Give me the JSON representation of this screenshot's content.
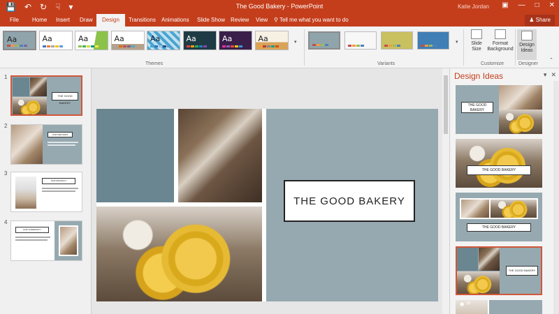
{
  "app": {
    "doc_title": "The Good Bakery - PowerPoint",
    "user": "Katie Jordan",
    "share_label": "Share"
  },
  "qat": {
    "save_icon": "save-icon",
    "undo_icon": "undo-icon",
    "redo_icon": "redo-icon",
    "touch_icon": "touch-mode-icon",
    "more_icon": "customize-qat-icon"
  },
  "tabs": [
    {
      "label": "File",
      "active": false
    },
    {
      "label": "Home",
      "active": false
    },
    {
      "label": "Insert",
      "active": false
    },
    {
      "label": "Draw",
      "active": false
    },
    {
      "label": "Design",
      "active": true
    },
    {
      "label": "Transitions",
      "active": false
    },
    {
      "label": "Animations",
      "active": false
    },
    {
      "label": "Slide Show",
      "active": false
    },
    {
      "label": "Review",
      "active": false
    },
    {
      "label": "View",
      "active": false
    }
  ],
  "tell_me": "Tell me what you want to do",
  "ribbon": {
    "themes_label": "Themes",
    "variants_label": "Variants",
    "customize_label": "Customize",
    "designer_label": "Designer",
    "theme_aa": "Aa",
    "slide_size_label": "Slide Size",
    "format_background_label": "Format Background",
    "design_ideas_label": "Design Ideas",
    "theme_colors": [
      [
        "#c0504d",
        "#f79646",
        "#9bbb59",
        "#4f81bd",
        "#8064a2"
      ],
      [
        "#4472c4",
        "#ed7d31",
        "#a5a5a5",
        "#ffc000",
        "#5b9bd5"
      ],
      [
        "#8bc34a",
        "#4caf50",
        "#cddc39",
        "#009688",
        "#ffeb3b"
      ],
      [
        "#a5a5a5",
        "#e46c0a",
        "#c0504d",
        "#7f6084",
        "#4bacc6"
      ],
      [
        "#3fa9d6",
        "#2e75b6",
        "#9dc3e6",
        "#1f4e79",
        "#5b9bd5"
      ],
      [
        "#e83e3e",
        "#f39c12",
        "#27ae60",
        "#2980b9",
        "#8e44ad"
      ],
      [
        "#e6339a",
        "#9b59b6",
        "#e74c3c",
        "#f1c40f",
        "#3498db"
      ],
      [
        "#e8a33b",
        "#c0392b",
        "#7f8c8d",
        "#16a085",
        "#d35400"
      ]
    ],
    "variant_colors": [
      {
        "bg": "#8fa4ab",
        "bars": [
          "#c0504d",
          "#f79646",
          "#9bbb59",
          "#4f81bd"
        ]
      },
      {
        "bg": "#f7f7f7",
        "bars": [
          "#c0504d",
          "#f79646",
          "#9bbb59",
          "#4f81bd"
        ]
      },
      {
        "bg": "#c9c060",
        "bars": [
          "#c0504d",
          "#f79646",
          "#9bbb59",
          "#4f81bd"
        ]
      },
      {
        "bg": "#3f7fb5",
        "bars": [
          "#c0504d",
          "#f79646",
          "#9bbb59",
          "#4f81bd"
        ]
      }
    ]
  },
  "slides": [
    {
      "num": "1",
      "title": "THE GOOD BAKERY"
    },
    {
      "num": "2",
      "title": "OUR METHODS"
    },
    {
      "num": "3",
      "title": "OUR PRODUCT"
    },
    {
      "num": "4",
      "title": "OUR COMMUNITY"
    }
  ],
  "main_slide": {
    "title": "THE GOOD BAKERY",
    "accent_color": "#96a9b0",
    "dark_accent": "#6a8690"
  },
  "design_ideas": {
    "title": "Design Ideas",
    "items": [
      {
        "label": "THE GOOD BAKERY"
      },
      {
        "label": "THE GOOD BAKERY"
      },
      {
        "label": "THE GOOD BAKERY"
      },
      {
        "label": "THE GOOD BAKERY"
      }
    ]
  },
  "colors": {
    "brand": "#c43e1c",
    "selection": "#d0573a"
  }
}
